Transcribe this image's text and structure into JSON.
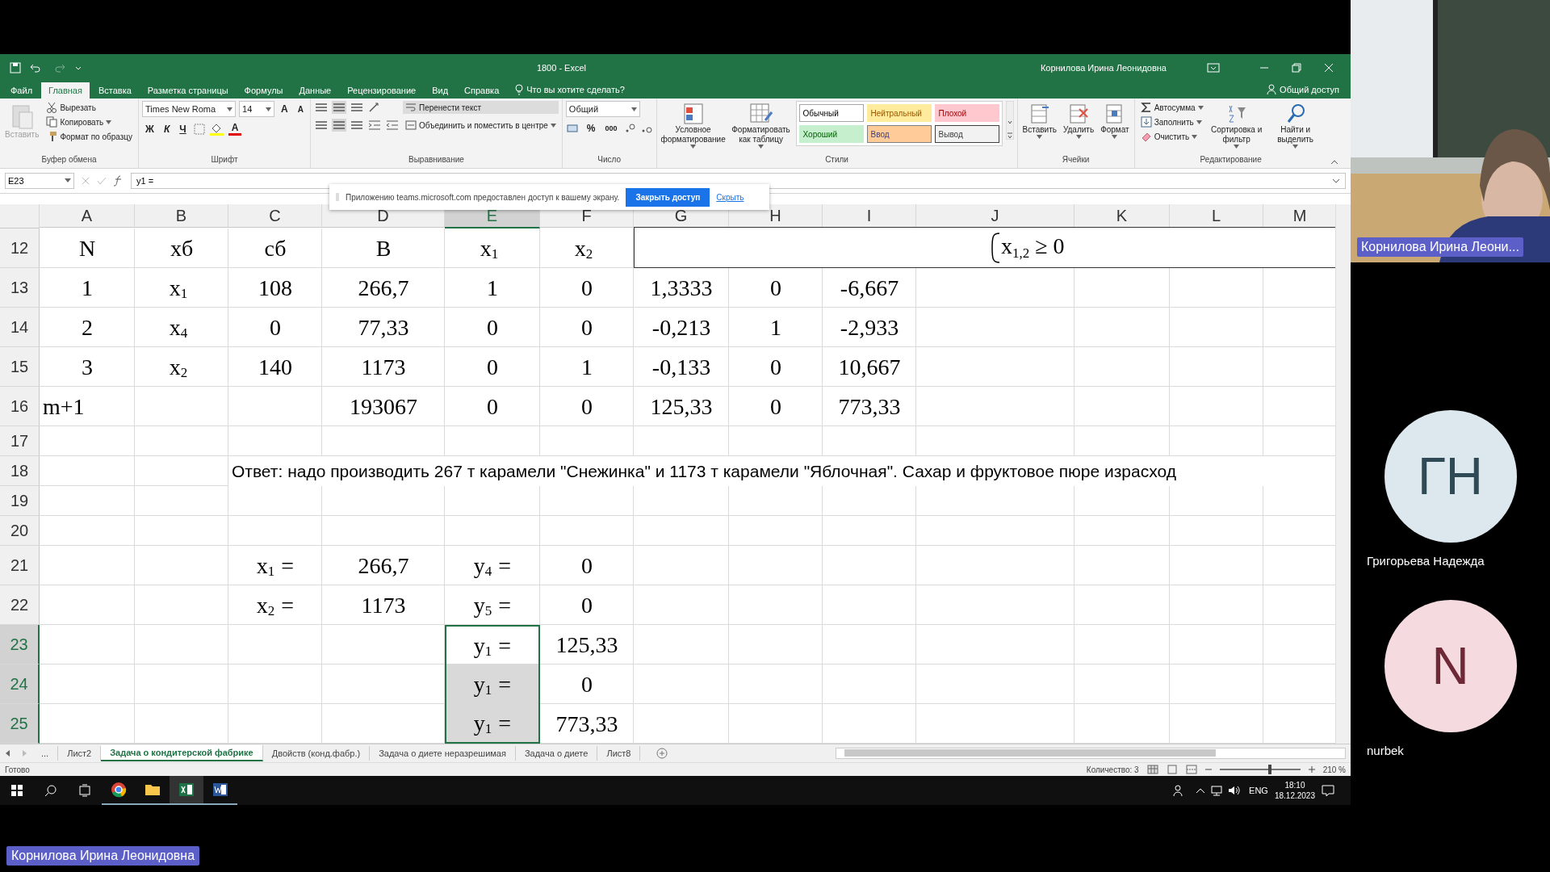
{
  "excel": {
    "title": "1800  -  Excel",
    "user": "Корнилова Ирина Леонидовна",
    "menu_tabs": [
      {
        "label": "Файл",
        "selected": false
      },
      {
        "label": "Главная",
        "selected": true
      },
      {
        "label": "Вставка",
        "selected": false
      },
      {
        "label": "Разметка страницы",
        "selected": false
      },
      {
        "label": "Формулы",
        "selected": false
      },
      {
        "label": "Данные",
        "selected": false
      },
      {
        "label": "Рецензирование",
        "selected": false
      },
      {
        "label": "Вид",
        "selected": false
      },
      {
        "label": "Справка",
        "selected": false
      }
    ],
    "tell_me": "Что вы хотите сделать?",
    "share": "Общий доступ",
    "clipboard": {
      "paste": "Вставить",
      "cut": "Вырезать",
      "copy": "Копировать",
      "format_painter": "Формат по образцу",
      "label": "Буфер обмена"
    },
    "font": {
      "family": "Times New Roma",
      "size": "14",
      "grow": "A",
      "shrink": "A",
      "bold": "Ж",
      "italic": "К",
      "underline": "Ч",
      "font_color": "A",
      "label": "Шрифт"
    },
    "alignment": {
      "wrap": "Перенести текст",
      "merge": "Объединить и поместить в центре",
      "label": "Выравнивание"
    },
    "number": {
      "format": "Общий",
      "percent": "%",
      "thousands": "000",
      "label": "Число"
    },
    "styles": {
      "conditional": "Условное форматирование",
      "as_table": "Форматировать как таблицу",
      "label": "Стили",
      "items": [
        {
          "label": "Обычный",
          "kind": "normal"
        },
        {
          "label": "Нейтральный",
          "kind": "neutral"
        },
        {
          "label": "Плохой",
          "kind": "bad"
        },
        {
          "label": "Хороший",
          "kind": "good"
        },
        {
          "label": "Ввод",
          "kind": "input"
        },
        {
          "label": "Вывод",
          "kind": "output"
        }
      ]
    },
    "cells": {
      "buttons": [
        "Вставить",
        "Удалить",
        "Формат"
      ],
      "label": "Ячейки"
    },
    "editing": {
      "autosum": "Автосумма",
      "fill": "Заполнить",
      "clear": "Очистить",
      "sort": "Сортировка и фильтр",
      "find": "Найти и выделить",
      "label": "Редактирование"
    },
    "formula_bar": {
      "name_box": "E23",
      "formula": "y1 ="
    },
    "notification": {
      "text": "Приложению teams.microsoft.com предоставлен доступ к вашему экрану.",
      "primary": "Закрыть доступ",
      "link": "Скрыть"
    },
    "columns": [
      {
        "label": "A",
        "selected": false
      },
      {
        "label": "B",
        "selected": false
      },
      {
        "label": "C",
        "selected": false
      },
      {
        "label": "D",
        "selected": false
      },
      {
        "label": "E",
        "selected": true
      },
      {
        "label": "F",
        "selected": false
      },
      {
        "label": "G",
        "selected": false
      },
      {
        "label": "H",
        "selected": false
      },
      {
        "label": "I",
        "selected": false
      },
      {
        "label": "J",
        "selected": false
      },
      {
        "label": "K",
        "selected": false
      },
      {
        "label": "L",
        "selected": false
      },
      {
        "label": "M",
        "selected": false
      }
    ],
    "textbox": {
      "text": "x$_{1,2}$ ≥ 0"
    },
    "rows": [
      {
        "number": "12",
        "kind": "data",
        "selected": false,
        "cells": {
          "A": "N",
          "B": "xб",
          "C": "сб",
          "D": "B",
          "E": "x$_{1}$",
          "F": "x$_{2}$"
        }
      },
      {
        "number": "13",
        "kind": "data",
        "selected": false,
        "cells": {
          "A": "1",
          "B": "x$_{1}$",
          "C": "108",
          "D": "266,7",
          "E": "1",
          "F": "0",
          "G": "1,3333",
          "H": "0",
          "I": "-6,667"
        }
      },
      {
        "number": "14",
        "kind": "data",
        "selected": false,
        "cells": {
          "A": "2",
          "B": "x$_{4}$",
          "C": "0",
          "D": "77,33",
          "E": "0",
          "F": "0",
          "G": "-0,213",
          "H": "1",
          "I": "-2,933"
        }
      },
      {
        "number": "15",
        "kind": "data",
        "selected": false,
        "cells": {
          "A": "3",
          "B": "x$_{2}$",
          "C": "140",
          "D": "1173",
          "E": "0",
          "F": "1",
          "G": "-0,133",
          "H": "0",
          "I": "10,667"
        }
      },
      {
        "number": "16",
        "kind": "data",
        "selected": false,
        "cells": {
          "A": "m+1",
          "D": "193067",
          "E": "0",
          "F": "0",
          "G": "125,33",
          "H": "0",
          "I": "773,33"
        }
      },
      {
        "number": "17",
        "kind": "empty",
        "selected": false
      },
      {
        "number": "18",
        "kind": "note",
        "selected": false,
        "note": "Ответ: надо производить 267 т карамели \"Снежинка\" и 1173 т карамели \"Яблочная\". Сахар и фруктовое пюре израсход"
      },
      {
        "number": "19",
        "kind": "empty",
        "selected": false
      },
      {
        "number": "20",
        "kind": "empty",
        "selected": false
      },
      {
        "number": "21",
        "kind": "data",
        "selected": false,
        "cells": {
          "C": "x$_{1}$ =",
          "D": "266,7",
          "E": "y$_{4}$ =",
          "F": "0"
        }
      },
      {
        "number": "22",
        "kind": "data",
        "selected": false,
        "cells": {
          "C": "x$_{2}$ =",
          "D": "1173",
          "E": "y$_{5}$ =",
          "F": "0"
        }
      },
      {
        "number": "23",
        "kind": "data",
        "selected": true,
        "cells": {
          "E": "y$_{1}$ =",
          "F": "125,33"
        }
      },
      {
        "number": "24",
        "kind": "data",
        "selected": true,
        "cells": {
          "E": "y$_{1}$ =",
          "F": "0"
        }
      },
      {
        "number": "25",
        "kind": "data",
        "selected": true,
        "cells": {
          "E": "y$_{1}$ =",
          "F": "773,33"
        }
      }
    ],
    "sheet_more": "...",
    "sheets": [
      {
        "label": "Лист2",
        "selected": false
      },
      {
        "label": "Задача о кондитерской фабрике",
        "selected": true
      },
      {
        "label": "Двойств (конд.фабр.)",
        "selected": false
      },
      {
        "label": "Задача о диете неразрешимая",
        "selected": false
      },
      {
        "label": "Задача о диете",
        "selected": false
      },
      {
        "label": "Лист8",
        "selected": false
      }
    ],
    "status": "Готово",
    "count": "Количество: 3",
    "zoom": "210 %",
    "zoom_slider": {
      "level": 0.62
    }
  },
  "taskbar": {
    "lang": "ENG",
    "time": "18:10",
    "date": "18.12.2023"
  },
  "presenter": "Корнилова Ирина Леонидовна",
  "participants": [
    {
      "kind": "video",
      "name": "Корнилова Ирина Леони..."
    },
    {
      "kind": "avatar",
      "initials": "ГН",
      "name": "Григорьева Надежда",
      "color": "#dde8ee"
    },
    {
      "kind": "avatar",
      "initials": "N",
      "name": "nurbek",
      "color": "#f5dbe0"
    }
  ]
}
